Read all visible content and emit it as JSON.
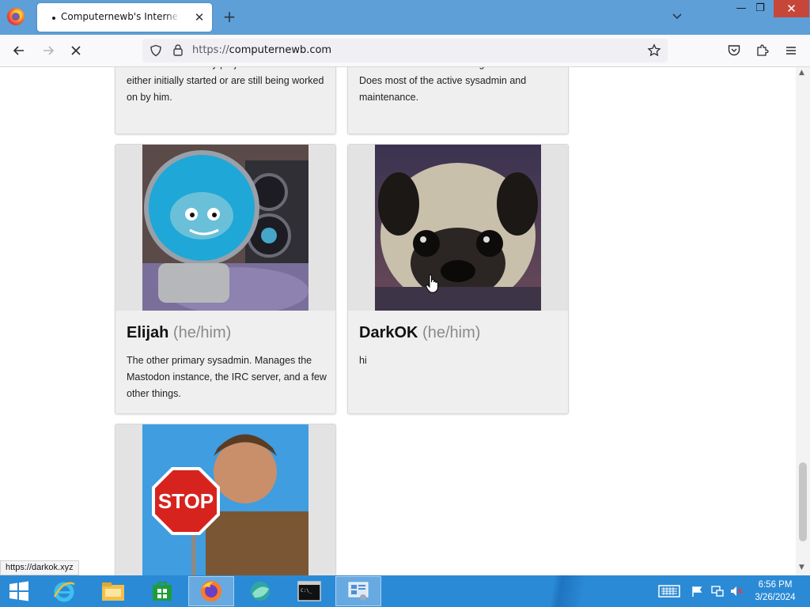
{
  "browser": {
    "tab_title": "Computernewb's Internet Pub",
    "tab_close": "✕",
    "new_tab": "+",
    "url_protocol": "https://",
    "url_host": "computernewb.com"
  },
  "window_controls": {
    "minimize": "—",
    "maximize": "❐",
    "close": "✕"
  },
  "page": {
    "top_cards": [
      {
        "bio": "runs the show. Many projects on this site were either initially started or are still being worked on by him."
      },
      {
        "bio": "alive at least half of the things on this site. Does most of the active sysadmin and maintenance."
      }
    ],
    "cards": [
      {
        "name": "Elijah",
        "pronouns": "(he/him)",
        "bio": "The other primary sysadmin. Manages the Mastodon instance, the IRC server, and a few other things."
      },
      {
        "name": "DarkOK",
        "pronouns": "(he/him)",
        "bio": "hi"
      }
    ],
    "third_card_sign": "STOP"
  },
  "status_link": "https://darkok.xyz",
  "taskbar": {
    "clock_time": "6:56 PM",
    "clock_date": "3/26/2024",
    "icons": [
      "start-icon",
      "internet-explorer-icon",
      "file-explorer-icon",
      "store-icon",
      "firefox-icon",
      "browser-icon",
      "command-prompt-icon",
      "control-panel-icon"
    ]
  },
  "colors": {
    "titlebar": "#5e9fd7",
    "taskbar": "#2b8ad6",
    "close_button": "#c7463a",
    "card_bg": "#efefef"
  }
}
